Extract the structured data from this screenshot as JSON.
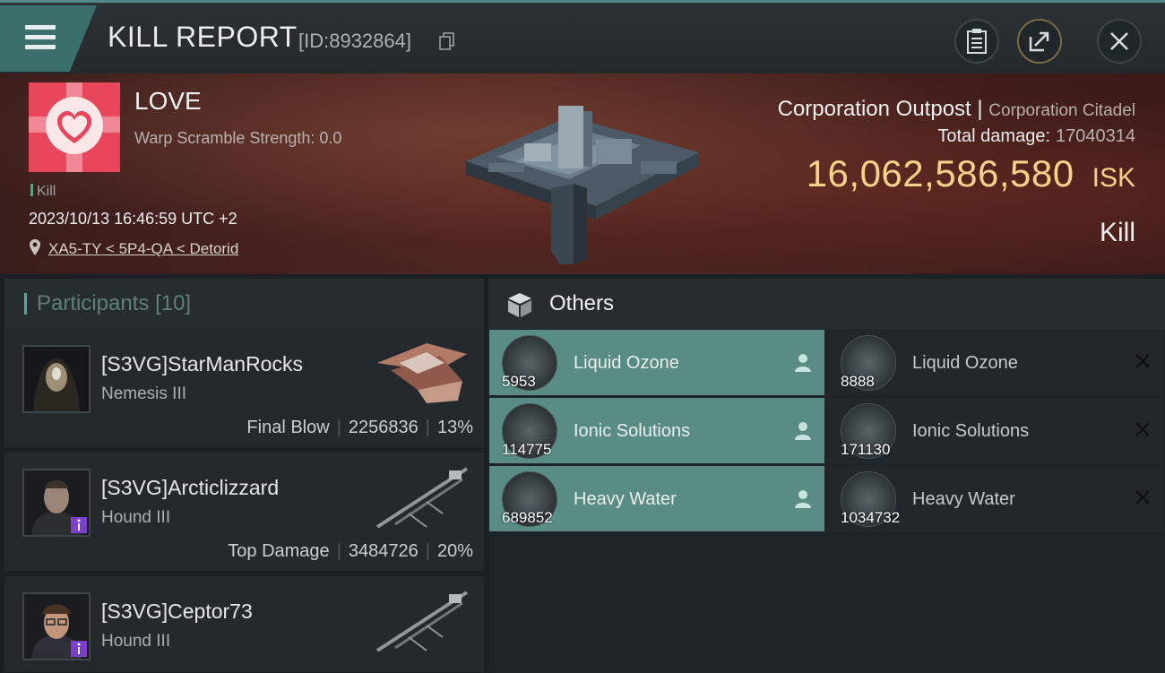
{
  "header": {
    "title": "KILL REPORT",
    "report_id": "[ID:8932864]"
  },
  "victim": {
    "name": "LOVE",
    "subtitle": "Warp Scramble Strength: 0.0",
    "tag": "Kill",
    "datetime": "2023/10/13 16:46:59 UTC +2",
    "location": "XA5-TY < 5P4-QA < Detorid",
    "ship_type": "Corporation Outpost",
    "ship_class": "Corporation Citadel",
    "total_damage_label": "Total damage:",
    "total_damage": "17040314",
    "isk_value": "16,062,586,580",
    "isk_unit": "ISK",
    "result": "Kill"
  },
  "participants": {
    "label": "Participants",
    "count": "[10]",
    "rows": [
      {
        "name": "[S3VG]StarManRocks",
        "ship": "Nemesis III",
        "role": "Final Blow",
        "damage": "2256836",
        "percent": "13%"
      },
      {
        "name": "[S3VG]Arcticlizzard",
        "ship": "Hound III",
        "role": "Top Damage",
        "damage": "3484726",
        "percent": "20%"
      },
      {
        "name": "[S3VG]Ceptor73",
        "ship": "Hound III"
      }
    ]
  },
  "others": {
    "label": "Others",
    "items": [
      {
        "name": "Liquid Ozone",
        "qty": "5953",
        "status": "dropped"
      },
      {
        "name": "Liquid Ozone",
        "qty": "8888",
        "status": "destroyed"
      },
      {
        "name": "Ionic Solutions",
        "qty": "114775",
        "status": "dropped"
      },
      {
        "name": "Ionic Solutions",
        "qty": "171130",
        "status": "destroyed"
      },
      {
        "name": "Heavy Water",
        "qty": "689852",
        "status": "dropped"
      },
      {
        "name": "Heavy Water",
        "qty": "1034732",
        "status": "destroyed"
      }
    ]
  },
  "colors": {
    "accent": "#5a8c86",
    "isk": "#f3d28a",
    "victim_icon": "#e8465a"
  }
}
